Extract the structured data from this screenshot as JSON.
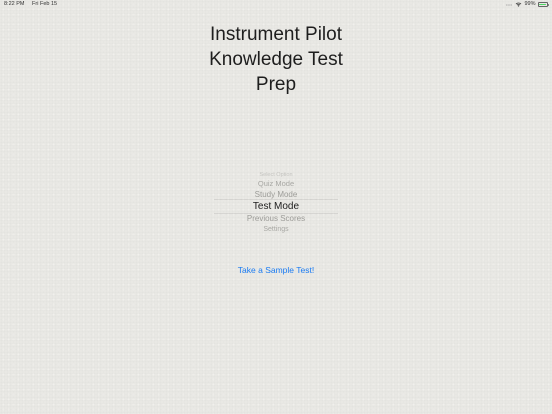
{
  "status_bar": {
    "time": "8:22 PM",
    "date": "Fri Feb 15",
    "battery": "99%",
    "battery_level": 0.99,
    "wifi_icon": "wifi-icon",
    "battery_icon": "battery-icon"
  },
  "title": {
    "line1": "Instrument Pilot",
    "line2": "Knowledge Test",
    "line3": "Prep"
  },
  "picker": {
    "items": [
      "Select Option",
      "Quiz Mode",
      "Study Mode",
      "Test Mode",
      "Previous Scores",
      "Settings"
    ],
    "selected": "Test Mode"
  },
  "sample_link": "Take a Sample Test!",
  "colors": {
    "background": "#e9e8e4",
    "link": "#1a7bf2",
    "battery": "#4cd964"
  }
}
